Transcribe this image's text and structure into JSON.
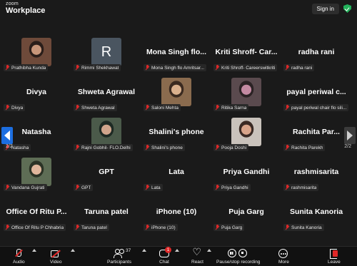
{
  "header": {
    "brand_small": "zoom",
    "brand_large": "Workplace",
    "signin_label": "Sign in",
    "security_icon": "shield-check-icon",
    "security_color": "#23b25b"
  },
  "pagination": {
    "left_page": "2/2",
    "right_page": "2/2",
    "left_icon": "chevron-left-icon",
    "right_icon": "chevron-right-icon"
  },
  "tiles": [
    {
      "display": "",
      "label": "Prathibha Kunda",
      "type": "photo",
      "photo_colors": [
        "#6e4a3a",
        "#c7967a",
        "#2a1e1a"
      ]
    },
    {
      "display": "R",
      "label": "Rimmi Shekhawat",
      "type": "letter"
    },
    {
      "display": "Mona Singh flo...",
      "label": "Mona Singh flo Amritsar...",
      "type": "name"
    },
    {
      "display": "Kriti Shroff- Car...",
      "label": "Kriti Shroff- Careerswitkriti",
      "type": "name"
    },
    {
      "display": "radha rani",
      "label": "radha rani",
      "type": "name"
    },
    {
      "display": "Divya",
      "label": "Divya",
      "type": "name"
    },
    {
      "display": "Shweta Agrawal",
      "label": "Shweta Agrawal",
      "type": "name"
    },
    {
      "display": "",
      "label": "Saloni Mehta",
      "type": "photo",
      "photo_colors": [
        "#8a6b4e",
        "#d9b08d",
        "#3a2a20"
      ]
    },
    {
      "display": "",
      "label": "Ritika Sarna",
      "type": "photo",
      "photo_colors": [
        "#5a4a4e",
        "#c48aa2",
        "#2b2224"
      ]
    },
    {
      "display": "payal periwal c...",
      "label": "payal periwal chair flo sili...",
      "type": "name"
    },
    {
      "display": "Natasha",
      "label": "Natasha",
      "type": "name"
    },
    {
      "display": "",
      "label": "Rajni Gobhil- FLO.Delhi",
      "type": "photo",
      "photo_colors": [
        "#4b5a4a",
        "#d0a58c",
        "#1e2a24"
      ]
    },
    {
      "display": "Shalini's phone",
      "label": "Shalini's phone",
      "type": "name"
    },
    {
      "display": "",
      "label": "Pooja Doshi",
      "type": "photo",
      "photo_colors": [
        "#c9c2bb",
        "#d8a48a",
        "#3a2a24"
      ]
    },
    {
      "display": "Rachita Par...",
      "label": "Rachita Parekh",
      "type": "name"
    },
    {
      "display": "",
      "label": "Vandana Gujrati",
      "type": "photo",
      "photo_colors": [
        "#5e6d55",
        "#e0b69c",
        "#2c3326"
      ]
    },
    {
      "display": "GPT",
      "label": "GPT",
      "type": "name"
    },
    {
      "display": "Lata",
      "label": "Lata",
      "type": "name"
    },
    {
      "display": "Priya Gandhi",
      "label": "Priya Gandhi",
      "type": "name"
    },
    {
      "display": "rashmisarita",
      "label": "rashmisarita",
      "type": "name"
    },
    {
      "display": "Office Of Ritu P...",
      "label": "Office Of Ritu P Chhabria",
      "type": "name"
    },
    {
      "display": "Taruna patel",
      "label": "Taruna patel",
      "type": "name"
    },
    {
      "display": "iPhone (10)",
      "label": "iPhone (10)",
      "type": "name"
    },
    {
      "display": "Puja Garg",
      "label": "Puja Garg",
      "type": "name"
    },
    {
      "display": "Sunita Kanoria",
      "label": "Sunita Kanoria",
      "type": "name"
    }
  ],
  "toolbar": {
    "audio_label": "Audio",
    "video_label": "Video",
    "participants_label": "Participants",
    "participants_count": "37",
    "chat_label": "Chat",
    "chat_badge": "1",
    "react_label": "React",
    "recording_label": "Pause/stop recording",
    "more_label": "More",
    "leave_label": "Leave",
    "muted_color": "#e02828"
  }
}
